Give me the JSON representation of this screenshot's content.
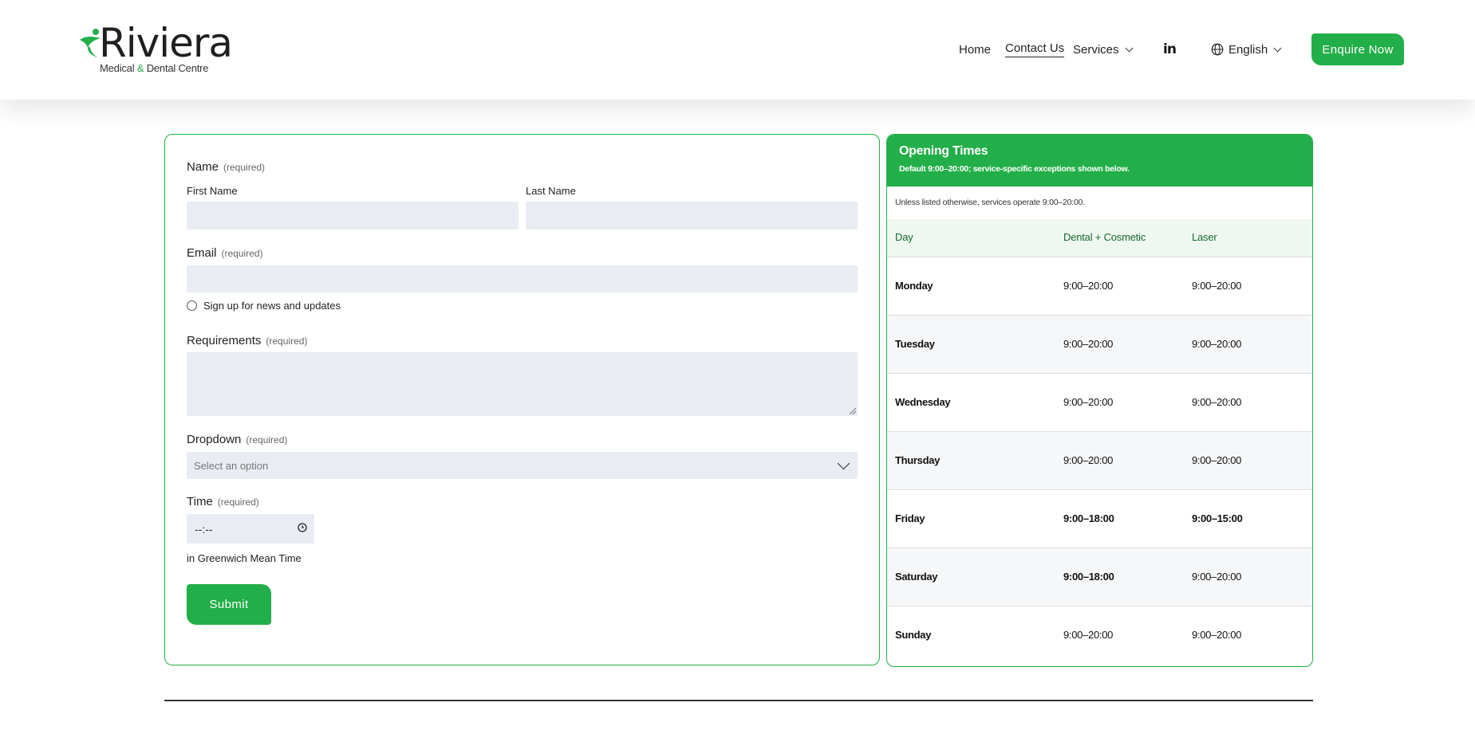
{
  "header": {
    "logo": {
      "word": "Riviera",
      "tagline_before": "Medical ",
      "tagline_amp": "&",
      "tagline_after": " Dental Centre"
    },
    "nav": {
      "home": "Home",
      "contact": "Contact Us",
      "services": "Services",
      "linkedin": "in",
      "language": "English"
    },
    "enquire_label": "Enquire Now"
  },
  "form": {
    "name_label": "Name",
    "required_tag": "(required)",
    "first_name_label": "First Name",
    "last_name_label": "Last Name",
    "email_label": "Email",
    "signup_label": "Sign up for news and updates",
    "requirements_label": "Requirements",
    "dropdown_label": "Dropdown",
    "dropdown_placeholder": "Select an option",
    "time_label": "Time",
    "time_placeholder": "--:--",
    "timezone_note": "in Greenwich Mean Time",
    "submit_label": "Submit"
  },
  "opening_times": {
    "title": "Opening Times",
    "subtitle": "Default 9:00–20:00; service-specific exceptions shown below.",
    "note": "Unless listed otherwise, services operate 9:00–20:00.",
    "columns": [
      "Day",
      "Dental + Cosmetic",
      "Laser"
    ],
    "rows": [
      {
        "day": "Monday",
        "dental": "9:00–20:00",
        "laser": "9:00–20:00"
      },
      {
        "day": "Tuesday",
        "dental": "9:00–20:00",
        "laser": "9:00–20:00"
      },
      {
        "day": "Wednesday",
        "dental": "9:00–20:00",
        "laser": "9:00–20:00"
      },
      {
        "day": "Thursday",
        "dental": "9:00–20:00",
        "laser": "9:00–20:00"
      },
      {
        "day": "Friday",
        "dental": "9:00–18:00",
        "laser": "9:00–15:00"
      },
      {
        "day": "Saturday",
        "dental": "9:00–18:00",
        "laser": "9:00–20:00"
      },
      {
        "day": "Sunday",
        "dental": "9:00–20:00",
        "laser": "9:00–20:00"
      }
    ]
  },
  "colors": {
    "brand_green": "#22ae48",
    "input_bg": "#e9ecf3",
    "table_head_bg": "#eef8f0"
  }
}
